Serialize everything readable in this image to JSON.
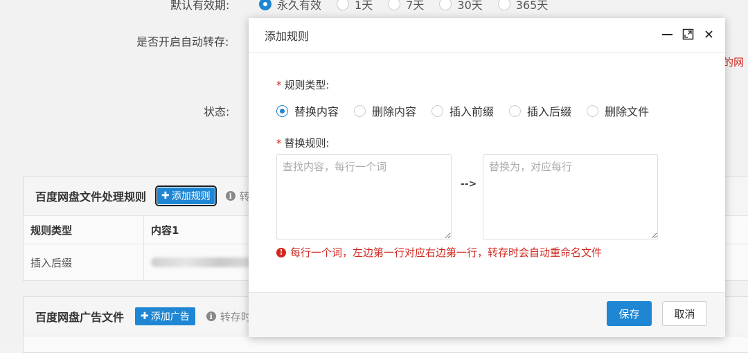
{
  "background": {
    "validity_label": "默认有效期:",
    "validity_options": [
      "永久有效",
      "1天",
      "7天",
      "30天",
      "365天"
    ],
    "auto_transfer_label": "是否开启自动转存:",
    "status_label": "状态:",
    "red_edge_text": "的网",
    "rules_panel": {
      "title": "百度网盘文件处理规则",
      "add_button": "添加规则",
      "hint": "转",
      "headers": [
        "规则类型",
        "内容1"
      ],
      "rows": [
        {
          "type": "插入后缀"
        }
      ]
    },
    "ads_panel": {
      "title": "百度网盘广告文件",
      "add_button": "添加广告",
      "hint": "转存时"
    }
  },
  "modal": {
    "title": "添加规则",
    "rule_type_label": "规则类型:",
    "rule_type_options": [
      "替换内容",
      "删除内容",
      "插入前缀",
      "插入后缀",
      "删除文件"
    ],
    "selected_rule_type": "替换内容",
    "replace_label": "替换规则:",
    "find_placeholder": "查找内容，每行一个词",
    "replace_placeholder": "替换为，对应每行",
    "arrow": "-->",
    "error": "每行一个词，左边第一行对应右边第一行，转存时会自动重命名文件",
    "save_button": "保存",
    "cancel_button": "取消"
  },
  "colors": {
    "accent": "#1e86d3",
    "error": "#d0271f"
  }
}
